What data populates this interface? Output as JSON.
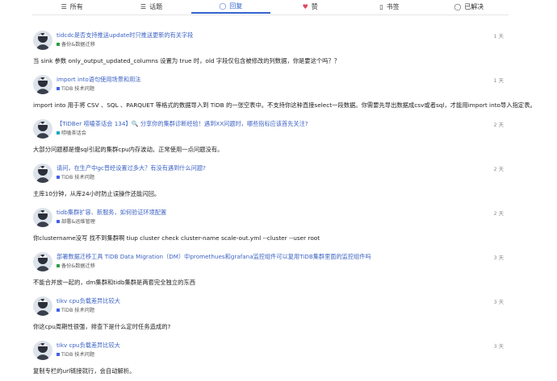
{
  "tabs": [
    {
      "icon": "list-icon",
      "glyph": "☰",
      "label": "所有",
      "active": false
    },
    {
      "icon": "topic-list-icon",
      "glyph": "☰",
      "label": "话题",
      "active": false
    },
    {
      "icon": "reply-bubble-icon",
      "glyph": "◯",
      "label": "回复",
      "active": true
    },
    {
      "icon": "heart-icon",
      "glyph": "♥",
      "label": "赞",
      "active": false,
      "color": "#e0455b"
    },
    {
      "icon": "bookmark-icon",
      "glyph": "▯",
      "label": "书签",
      "active": false
    },
    {
      "icon": "check-circle-icon",
      "glyph": "◯",
      "label": "已解决",
      "active": false
    }
  ],
  "colors": {
    "accent": "#3264d0",
    "category_green": "#2f9e44",
    "category_teal": "#15aabf",
    "category_blue": "#4263eb"
  },
  "feed": [
    {
      "title": "tidcdc是否支持推送update时只推送更新的有关字段",
      "category": "备份&数据迁移",
      "category_color": "#2f9e44",
      "time": "1 天",
      "excerpt": "当 sink 参数 only_output_updated_columns 设置为 true 时，old 字段仅包含被修改的列数据，你是要这个吗？？"
    },
    {
      "title": "import into语句使用场景和用法",
      "category": "TiDB 技术问题",
      "category_color": "#4263eb",
      "time": "1 天",
      "excerpt": "import into 用于将 CSV 、SQL 、PARQUET 等格式的数据导入到 TiDB 的一张空表中。不支持你这种直接select一段数据。你需要先导出数据成csv或者sql，才能用import into导入指定表。"
    },
    {
      "title": "【TiDBer 唠嗑茶话会 134】🔍 分享你的集群诊断经验！遇到XX问题时，哪些指标应该首先关注?",
      "category": "唠嗑茶话会",
      "category_color": "#15aabf",
      "time": "2 天",
      "excerpt": "大部分问题都是慢sql引起的集群cpu内存波动。正常使用一点问题没有。"
    },
    {
      "title": "请问，在生产中gc普经设置过多大？有没有遇到什么问题?",
      "category": "TiDB 技术问题",
      "category_color": "#4263eb",
      "time": "2 天",
      "excerpt": "主库10分钟，从库24小时防止误操作还能闪回。"
    },
    {
      "title": "tidb集群扩容、新服务，如何验证环境配置",
      "category": "部署&运维管理",
      "category_color": "#4263eb",
      "time": "2 天",
      "excerpt": "你clustername没写 找不到集群啊 tiup cluster check cluster-name scale-out.yml --cluster --user root"
    },
    {
      "title": "部署数据迁移工具 TiDB Data Migration（DM）中promethues和grafana监控组件可以复用TiDB集群里面的监控组件吗",
      "category": "备份&数据迁移",
      "category_color": "#2f9e44",
      "time": "3 天",
      "excerpt": "不能合并放一起的，dm集群和tidb集群是两套完全独立的东西"
    },
    {
      "title": "tikv cpu负载差异比较大",
      "category": "TiDB 技术问题",
      "category_color": "#4263eb",
      "time": "3 天",
      "excerpt": "你这cpu周期性很强，排查下是什么定时任务造成的?"
    },
    {
      "title": "tikv cpu负载差异比较大",
      "category": "TiDB 技术问题",
      "category_color": "#4263eb",
      "time": "3 天",
      "excerpt": "复制专栏的url链接就行，会自动解析。"
    }
  ]
}
